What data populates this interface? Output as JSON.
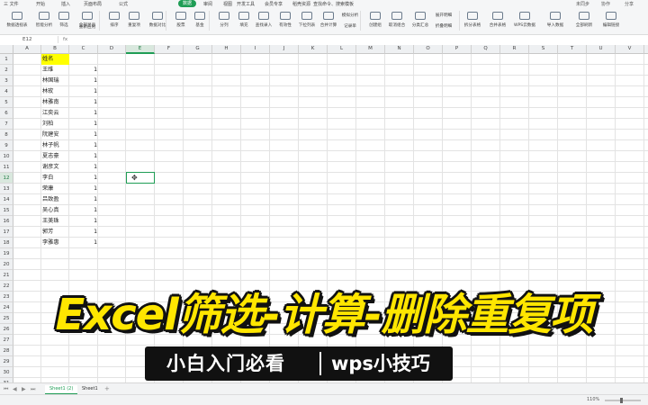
{
  "ribbon": {
    "tabs": [
      "三 文件",
      "开始",
      "插入",
      "页面布局",
      "公式",
      "数据",
      "审阅",
      "视图",
      "开发工具",
      "会员专享",
      "稻壳资源",
      "查找命令、搜索模板"
    ],
    "active_tab": "数据",
    "top_right": [
      "未同步",
      "协作",
      "分享"
    ],
    "buttons": [
      "数据透视表",
      "智能分析",
      "筛选",
      "全部显示",
      "重新应用",
      "排序",
      "重复项",
      "数据对比",
      "股票",
      "基金",
      "分列",
      "填充",
      "查找录入",
      "有效性",
      "下拉列表",
      "合并计算",
      "模拟分析",
      "记录单",
      "创建组",
      "取消组合",
      "分类汇总",
      "展开明细",
      "折叠明细",
      "拆分表格",
      "合并表格",
      "WPS云数据",
      "导入数据",
      "全部刷新",
      "编辑链接"
    ]
  },
  "formula_bar": {
    "cell_ref": "E12",
    "fx": "fx"
  },
  "columns": [
    "A",
    "B",
    "C",
    "D",
    "E",
    "F",
    "G",
    "H",
    "I",
    "J",
    "K",
    "L",
    "M",
    "N",
    "O",
    "P",
    "Q",
    "R",
    "S",
    "T",
    "U",
    "V",
    "W"
  ],
  "selected_column": "E",
  "rows": [
    1,
    2,
    3,
    4,
    5,
    6,
    7,
    8,
    9,
    10,
    11,
    12,
    13,
    14,
    15,
    16,
    17,
    18,
    19,
    20,
    21,
    22,
    23,
    24,
    25,
    26,
    27,
    28,
    29,
    30,
    31
  ],
  "selected_row": 12,
  "header_cell": "姓名",
  "names": [
    "王维",
    "林国瑞",
    "林玫",
    "林雅南",
    "江奕云",
    "刘柏",
    "阮建安",
    "林子帆",
    "夏志豪",
    "谢彦文",
    "李白",
    "荣康",
    "吕致盈",
    "吴心真",
    "王美珠",
    "郭芳",
    "李雅惠"
  ],
  "counts": [
    "1",
    "1",
    "1",
    "1",
    "1",
    "1",
    "1",
    "1",
    "1",
    "1",
    "1",
    "1",
    "1",
    "1",
    "1",
    "1",
    "1"
  ],
  "sheets": [
    "Sheet1 (2)",
    "Sheet1"
  ],
  "active_sheet": "Sheet1 (2)",
  "status": {
    "zoom": "110%"
  },
  "title_overlay": "Excel筛选-计算-删除重复项",
  "subtitle": {
    "left": "小白入门必看",
    "right": "wps小技巧"
  },
  "colors": {
    "accent": "#1f9d55",
    "highlight": "#ffff00",
    "title": "#ffe600"
  }
}
